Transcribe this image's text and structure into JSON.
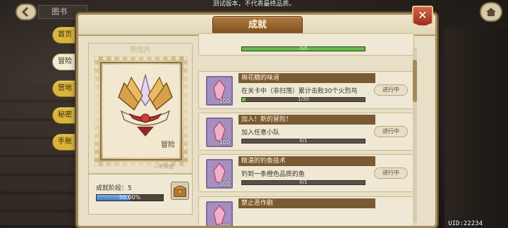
{
  "notice": "测试版本，不代表最终品质。",
  "uid": "UID:22234",
  "topbar": {
    "left_title": "图书"
  },
  "side_tabs": [
    {
      "label": "首页",
      "active": false
    },
    {
      "label": "冒险",
      "active": true
    },
    {
      "label": "营地",
      "active": false
    },
    {
      "label": "秘密",
      "active": false
    },
    {
      "label": "手账",
      "active": false
    }
  ],
  "panel": {
    "title": "成就"
  },
  "card": {
    "title": "明信片",
    "stamp_label": "冒险",
    "signature": "—萨菲娅"
  },
  "stage": {
    "label": "成就阶段：5",
    "percent_text": "50.00%",
    "percent": 50
  },
  "achievements": [
    {
      "title": "",
      "desc": "",
      "progress_text": "0/0",
      "progress": 1.0,
      "count": "",
      "status": ""
    },
    {
      "title": "棉花糖的味道",
      "desc": "在关卡中（非扫荡）累计击败30个火烈鸟",
      "progress_text": "1/30",
      "progress": 0.03,
      "count": "100",
      "status": "进行中"
    },
    {
      "title": "加入！新的冒险！",
      "desc": "加入任意小队",
      "progress_text": "0/1",
      "progress": 0,
      "count": "100",
      "status": "进行中"
    },
    {
      "title": "精湛的钓鱼技术",
      "desc": "钓到一条橙色品质的鱼",
      "progress_text": "0/1",
      "progress": 0,
      "count": "100",
      "status": "进行中"
    },
    {
      "title": "禁止恶作剧",
      "desc": "",
      "progress_text": "",
      "progress": 0,
      "count": "100",
      "status": ""
    }
  ],
  "colors": {
    "accent": "#a48a58",
    "progress_green": "#5fbf45",
    "stage_blue": "#3d78bf"
  }
}
